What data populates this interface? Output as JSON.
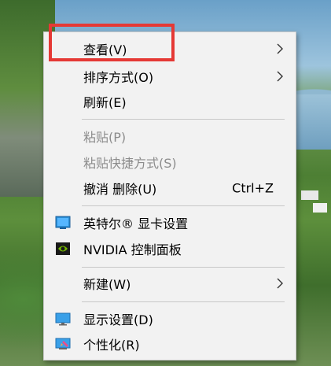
{
  "context_menu": {
    "items": [
      {
        "label": "查看(V)"
      },
      {
        "label": "排序方式(O)"
      },
      {
        "label": "刷新(E)"
      },
      {
        "label": "粘贴(P)"
      },
      {
        "label": "粘贴快捷方式(S)"
      },
      {
        "label": "撤消 删除(U)",
        "shortcut": "Ctrl+Z"
      },
      {
        "label": "英特尔® 显卡设置",
        "icon": "intel-graphics-icon"
      },
      {
        "label": "NVIDIA 控制面板",
        "icon": "nvidia-icon"
      },
      {
        "label": "新建(W)"
      },
      {
        "label": "显示设置(D)",
        "icon": "display-icon"
      },
      {
        "label": "个性化(R)",
        "icon": "personalize-icon"
      }
    ]
  },
  "colors": {
    "menu_bg": "#f2f2f2",
    "disabled_text": "#8c8c8c",
    "highlight": "#e53935"
  }
}
